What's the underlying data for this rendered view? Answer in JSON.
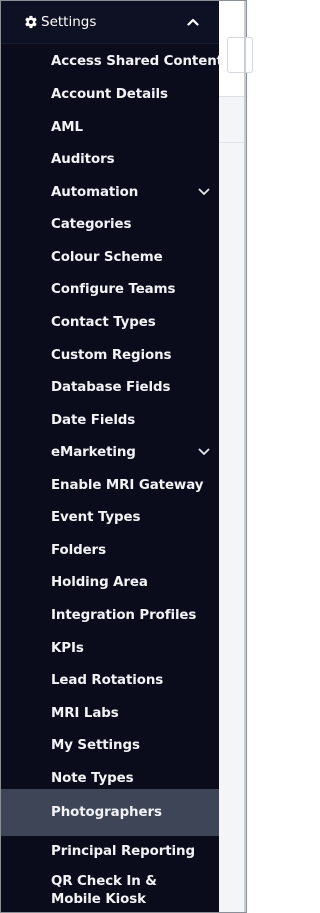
{
  "header": {
    "label": "Settings",
    "icon": "gear-icon",
    "collapse_icon": "chevron-up-icon"
  },
  "items": [
    {
      "label": "Access Shared Content"
    },
    {
      "label": "Account Details"
    },
    {
      "label": "AML"
    },
    {
      "label": "Auditors"
    },
    {
      "label": "Automation",
      "expandable": true
    },
    {
      "label": "Categories"
    },
    {
      "label": "Colour Scheme"
    },
    {
      "label": "Configure Teams"
    },
    {
      "label": "Contact Types"
    },
    {
      "label": "Custom Regions"
    },
    {
      "label": "Database Fields"
    },
    {
      "label": "Date Fields"
    },
    {
      "label": "eMarketing",
      "expandable": true
    },
    {
      "label": "Enable MRI Gateway"
    },
    {
      "label": "Event Types"
    },
    {
      "label": "Folders"
    },
    {
      "label": "Holding Area"
    },
    {
      "label": "Integration Profiles"
    },
    {
      "label": "KPIs"
    },
    {
      "label": "Lead Rotations"
    },
    {
      "label": "MRI Labs"
    },
    {
      "label": "My Settings"
    },
    {
      "label": "Note Types"
    },
    {
      "label": "Photographers",
      "active": true
    },
    {
      "label": "Principal Reporting"
    },
    {
      "label": "QR Check In & Mobile Kiosk"
    }
  ],
  "colors": {
    "menu_bg": "#0a0c1c",
    "active_bg": "#3d4557",
    "text": "#f2f3f7"
  }
}
